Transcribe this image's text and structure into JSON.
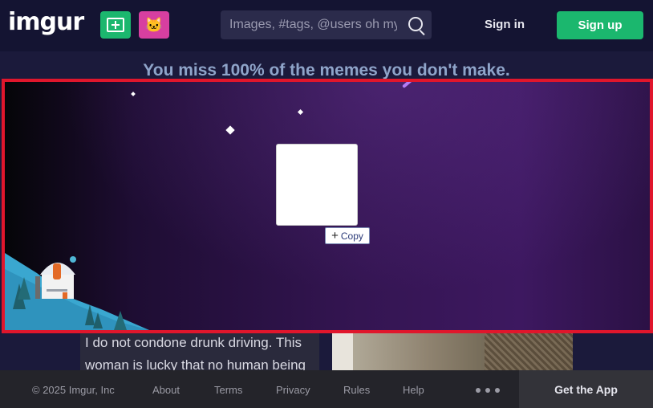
{
  "header": {
    "logo": "imgur",
    "search_placeholder": "Images, #tags, @users oh my!",
    "sign_in": "Sign in",
    "sign_up": "Sign up",
    "icons": {
      "new_post": "plus-square-icon",
      "random": "cat-icon",
      "search": "search-icon"
    }
  },
  "tagline": "You miss 100% of the memes you don't make.",
  "ad": {
    "copy_label": "Copy"
  },
  "background_post": {
    "text": "I do not condone drunk driving. This woman is lucky that no human being"
  },
  "footer": {
    "copyright": "© 2025 Imgur, Inc",
    "links": [
      "About",
      "Terms",
      "Privacy",
      "Rules",
      "Help"
    ],
    "get_app": "Get the App"
  },
  "colors": {
    "brand_green": "#1bb76e",
    "brand_pink": "#d73fa0",
    "highlight_border": "#e0162c"
  }
}
